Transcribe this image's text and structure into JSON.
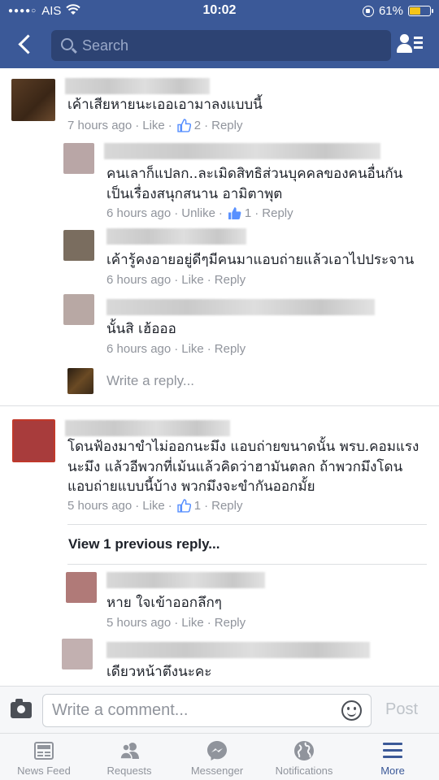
{
  "status_bar": {
    "signal": "●●●●○",
    "carrier": "AIS",
    "time": "10:02",
    "battery_text": "61%",
    "battery_level": 0.61,
    "battery_color": "#f5c518"
  },
  "header": {
    "search_placeholder": "Search",
    "brand_color": "#3b5998"
  },
  "comments": [
    {
      "text": "เค้าเสียหายนะเออเอามาลงแบบนี้",
      "time": "7 hours ago",
      "like_action": "Like",
      "like_count": "2",
      "reply": "Reply",
      "replies": [
        {
          "text_lines": [
            "คนเลาก็แปลก..ละเมิดสิทธิส่วนบุคคลของคนอื่นกัน",
            "เป็นเรื่องสนุกสนาน อามิตาพุต"
          ],
          "time": "6 hours ago",
          "like_action": "Unlike",
          "like_count": "1",
          "reply": "Reply"
        },
        {
          "text_lines": [
            "เค้ารู้คงอายอยู่ดีๆมีคนมาแอบถ่ายแล้วเอาไปประจาน"
          ],
          "time": "6 hours ago",
          "like_action": "Like",
          "reply": "Reply"
        },
        {
          "text_lines": [
            "นั้นสิ เฮ้อออ"
          ],
          "time": "6 hours ago",
          "like_action": "Like",
          "reply": "Reply"
        }
      ],
      "write_reply_placeholder": "Write a reply..."
    },
    {
      "text_lines": [
        "โดนฟ้องมาขำไม่ออกนะมึง แอบถ่ายขนาดนั้น พรบ.คอมแรง",
        "นะมึง แล้วอีพวกที่เม้นแล้วคิดว่าฮามันตลก ถ้าพวกมึงโดน",
        "แอบถ่ายแบบนี้บ้าง พวกมึงจะขำกันออกมั้ย"
      ],
      "time": "5 hours ago",
      "like_action": "Like",
      "like_count": "1",
      "reply": "Reply",
      "view_previous": "View 1 previous reply...",
      "replies": [
        {
          "text_lines": [
            "หาย ใจเข้าออกลึกๆ"
          ],
          "time": "5 hours ago",
          "like_action": "Like",
          "reply": "Reply"
        },
        {
          "text_lines": [
            "เดียวหน้าตึงนะคะ"
          ]
        }
      ]
    }
  ],
  "composer": {
    "placeholder": "Write a comment...",
    "post_label": "Post"
  },
  "tabs": [
    {
      "label": "News Feed",
      "icon": "news-feed-icon"
    },
    {
      "label": "Requests",
      "icon": "friend-requests-icon"
    },
    {
      "label": "Messenger",
      "icon": "messenger-icon"
    },
    {
      "label": "Notifications",
      "icon": "globe-icon"
    },
    {
      "label": "More",
      "icon": "hamburger-menu-icon",
      "active": true
    }
  ],
  "colors": {
    "accent": "#3b5998",
    "like_blue": "#5890ff",
    "meta_gray": "#90949c"
  }
}
